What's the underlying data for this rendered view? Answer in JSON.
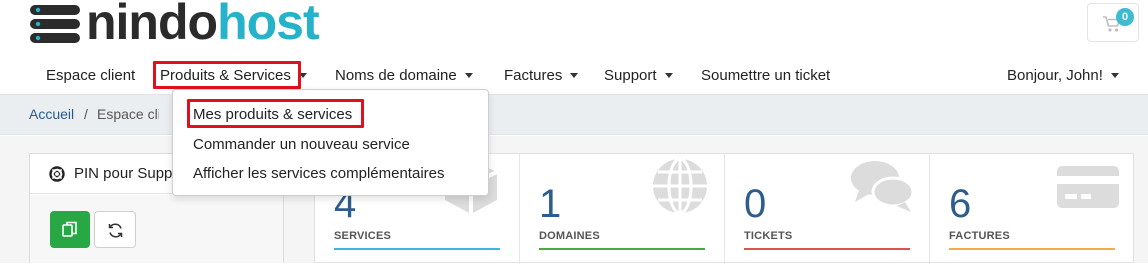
{
  "brand": {
    "name_dark": "nindo",
    "name_teal": "host",
    "color_dark": "#2b2b2b",
    "color_teal": "#26b3c9"
  },
  "cart": {
    "count": "0",
    "icon": "cart-icon"
  },
  "nav": {
    "items": [
      {
        "label": "Espace client"
      },
      {
        "label": "Produits & Services",
        "has_caret": true,
        "highlighted": true
      },
      {
        "label": "Noms de domaine",
        "has_caret": true
      },
      {
        "label": "Factures",
        "has_caret": true
      },
      {
        "label": "Support",
        "has_caret": true
      },
      {
        "label": "Soumettre un ticket"
      }
    ],
    "account": {
      "label": "Bonjour, John!",
      "has_caret": true
    }
  },
  "breadcrumb": {
    "home": "Accueil",
    "separator": "/",
    "current": "Espace client"
  },
  "dropdown": {
    "items": [
      {
        "label": "Mes produits & services",
        "highlighted": true
      },
      {
        "label": "Commander un nouveau service"
      },
      {
        "label": "Afficher les services complémentaires"
      }
    ]
  },
  "pin_card": {
    "title": "PIN pour Support"
  },
  "stats": [
    {
      "value": "4",
      "label": "SERVICES",
      "color": "#3db7e0",
      "icon": "cube-icon"
    },
    {
      "value": "1",
      "label": "DOMAINES",
      "color": "#49a942",
      "icon": "globe-icon"
    },
    {
      "value": "0",
      "label": "TICKETS",
      "color": "#d9534f",
      "icon": "comments-icon"
    },
    {
      "value": "6",
      "label": "FACTURES",
      "color": "#f0ad4e",
      "icon": "credit-card-icon"
    }
  ],
  "highlight_color": "#e0101c"
}
